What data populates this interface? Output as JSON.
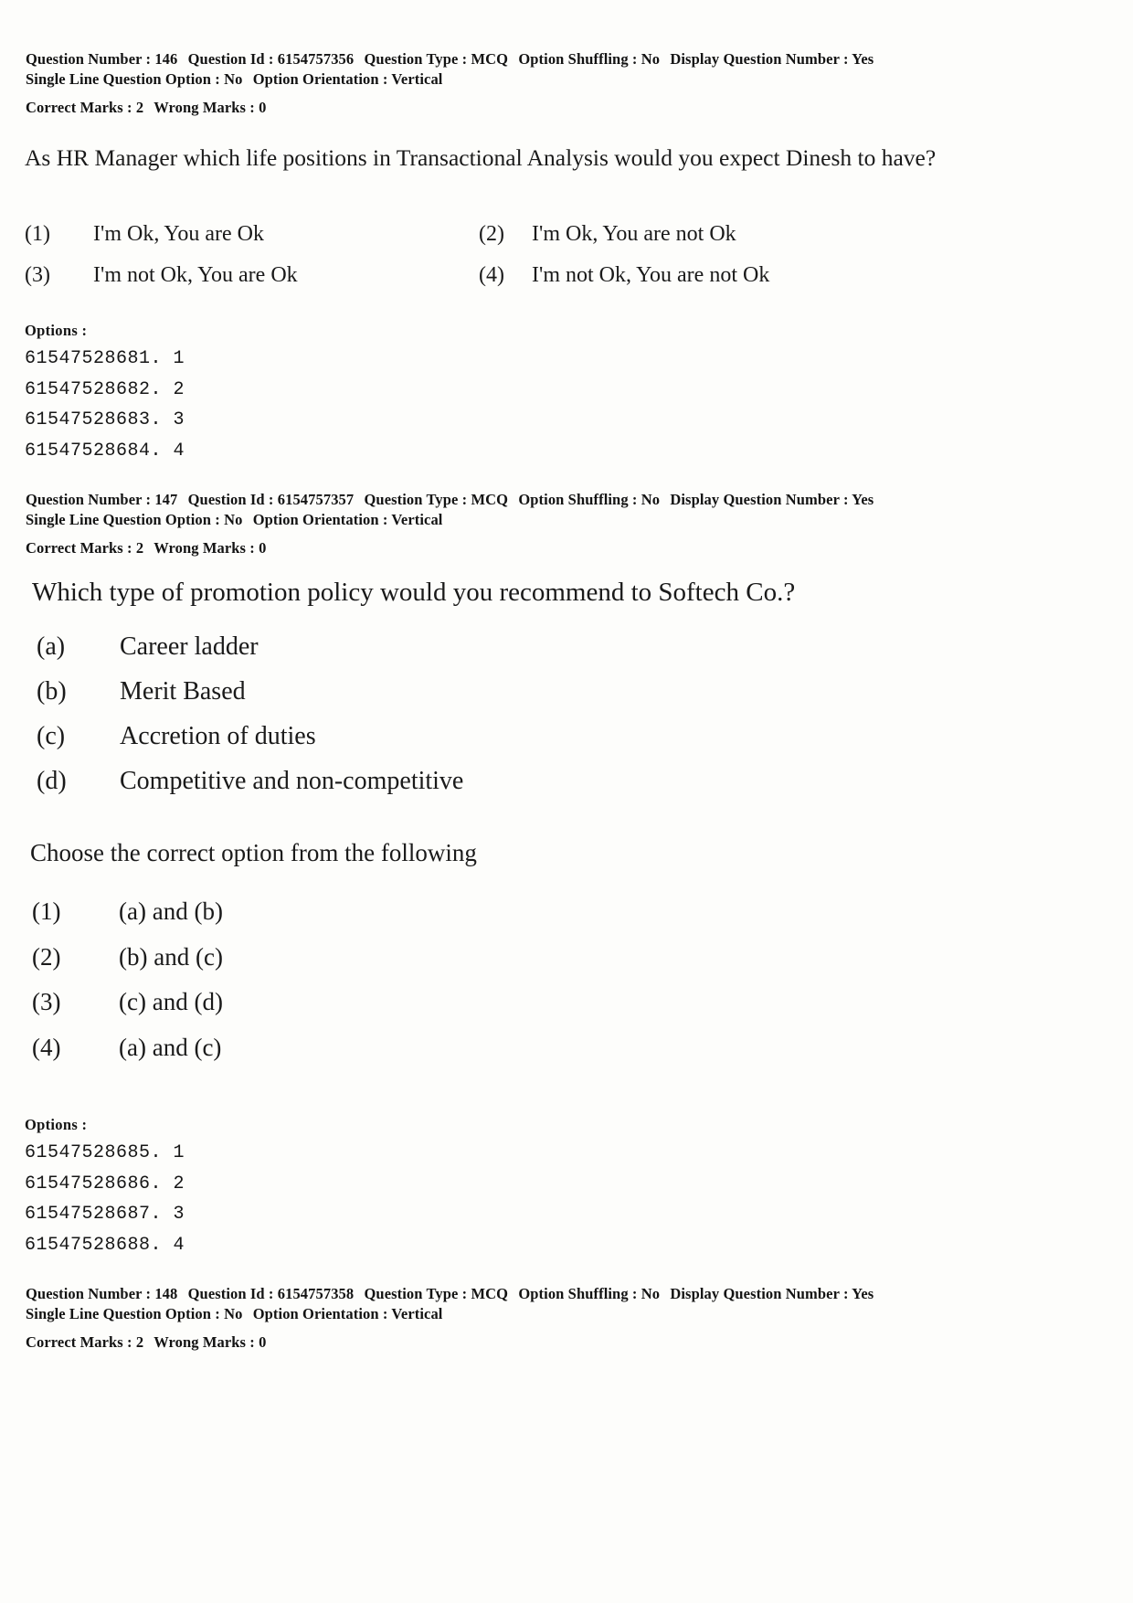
{
  "page": {
    "background_color": "#fdfdfb",
    "text_color": "#1a1a1a"
  },
  "questions": [
    {
      "meta": {
        "question_number_label": "Question Number :",
        "question_number": "146",
        "question_id_label": "Question Id :",
        "question_id": "6154757356",
        "question_type_label": "Question Type :",
        "question_type": "MCQ",
        "option_shuffling_label": "Option Shuffling :",
        "option_shuffling": "No",
        "display_question_number_label": "Display Question Number :",
        "display_question_number": "Yes",
        "single_line_question_option_label": "Single Line Question Option :",
        "single_line_question_option": "No",
        "option_orientation_label": "Option Orientation :",
        "option_orientation": "Vertical",
        "correct_marks_label": "Correct Marks :",
        "correct_marks": "2",
        "wrong_marks_label": "Wrong Marks :",
        "wrong_marks": "0"
      },
      "stem": "As HR Manager which life positions in Transactional Analysis would you expect Dinesh to have?",
      "choices": [
        {
          "label": "(1)",
          "text": "I'm Ok, You are Ok"
        },
        {
          "label": "(2)",
          "text": "I'm Ok, You are not Ok"
        },
        {
          "label": "(3)",
          "text": "I'm not Ok, You are Ok"
        },
        {
          "label": "(4)",
          "text": "I'm not Ok, You are not Ok"
        }
      ],
      "options_label": "Options :",
      "option_ids": [
        "61547528681. 1",
        "61547528682. 2",
        "61547528683. 3",
        "61547528684. 4"
      ]
    },
    {
      "meta": {
        "question_number_label": "Question Number :",
        "question_number": "147",
        "question_id_label": "Question Id :",
        "question_id": "6154757357",
        "question_type_label": "Question Type :",
        "question_type": "MCQ",
        "option_shuffling_label": "Option Shuffling :",
        "option_shuffling": "No",
        "display_question_number_label": "Display Question Number :",
        "display_question_number": "Yes",
        "single_line_question_option_label": "Single Line Question Option :",
        "single_line_question_option": "No",
        "option_orientation_label": "Option Orientation :",
        "option_orientation": "Vertical",
        "correct_marks_label": "Correct Marks :",
        "correct_marks": "2",
        "wrong_marks_label": "Wrong Marks :",
        "wrong_marks": "0"
      },
      "stem": "Which type of promotion policy would you recommend to Softech Co.?",
      "sub_items": [
        {
          "label": "(a)",
          "text": "Career ladder"
        },
        {
          "label": "(b)",
          "text": "Merit Based"
        },
        {
          "label": "(c)",
          "text": "Accretion of duties"
        },
        {
          "label": "(d)",
          "text": "Competitive and non-competitive"
        }
      ],
      "instruction": "Choose the correct option from the following",
      "choices": [
        {
          "label": "(1)",
          "text": "(a) and (b)"
        },
        {
          "label": "(2)",
          "text": "(b) and (c)"
        },
        {
          "label": "(3)",
          "text": "(c) and (d)"
        },
        {
          "label": "(4)",
          "text": "(a) and (c)"
        }
      ],
      "options_label": "Options :",
      "option_ids": [
        "61547528685. 1",
        "61547528686. 2",
        "61547528687. 3",
        "61547528688. 4"
      ]
    },
    {
      "meta": {
        "question_number_label": "Question Number :",
        "question_number": "148",
        "question_id_label": "Question Id :",
        "question_id": "6154757358",
        "question_type_label": "Question Type :",
        "question_type": "MCQ",
        "option_shuffling_label": "Option Shuffling :",
        "option_shuffling": "No",
        "display_question_number_label": "Display Question Number :",
        "display_question_number": "Yes",
        "single_line_question_option_label": "Single Line Question Option :",
        "single_line_question_option": "No",
        "option_orientation_label": "Option Orientation :",
        "option_orientation": "Vertical",
        "correct_marks_label": "Correct Marks :",
        "correct_marks": "2",
        "wrong_marks_label": "Wrong Marks :",
        "wrong_marks": "0"
      }
    }
  ]
}
